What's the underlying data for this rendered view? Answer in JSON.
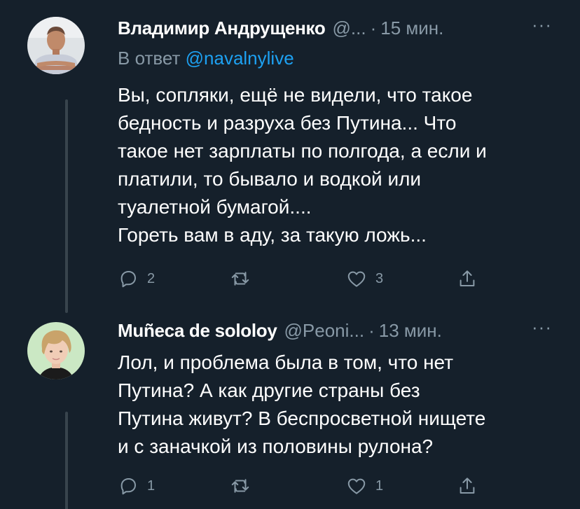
{
  "tweets": [
    {
      "author_name": "Владимир Андрущенко",
      "handle": "@...",
      "dot": "·",
      "time": "15 мин.",
      "more": "···",
      "reply_prefix": "В ответ ",
      "reply_to": "@navalnylive",
      "body_lines": [
        "Вы, сопляки, ещё не видели, что такое",
        "бедность и разруха без Путина... Что",
        "такое нет зарплаты по полгода, а если и",
        "платили, то бывало и водкой или",
        "туалетной бумагой....",
        "Гореть вам в аду, за такую ложь..."
      ],
      "reply_count": "2",
      "retweet_count": "",
      "like_count": "3",
      "avatar_colors": {
        "bg": "#dfe3e6",
        "skin": "#c08a6a",
        "hair": "#6b4a3a",
        "shirt": "#c7ccd8"
      }
    },
    {
      "author_name": "Muñeca de sololoy",
      "handle": "@Peoni...",
      "dot": "·",
      "time": "13 мин.",
      "more": "···",
      "body_lines": [
        "Лол, и проблема была в том, что нет",
        "Путина? А как другие страны без",
        "Путина живут? В беспросветной нищете",
        "и с заначкой из половины рулона?"
      ],
      "reply_count": "1",
      "retweet_count": "",
      "like_count": "1",
      "avatar_colors": {
        "bg": "#cbe8c4",
        "skin": "#f0cdb6",
        "hair": "#c9a36a",
        "shirt": "#1b1b1b"
      }
    }
  ],
  "colors": {
    "background": "#15202b",
    "text_primary": "#ffffff",
    "text_secondary": "#8899a6",
    "link": "#1da1f2",
    "thread_line": "#38444d"
  },
  "icons": [
    "reply-icon",
    "retweet-icon",
    "like-icon",
    "share-icon",
    "more-icon"
  ]
}
